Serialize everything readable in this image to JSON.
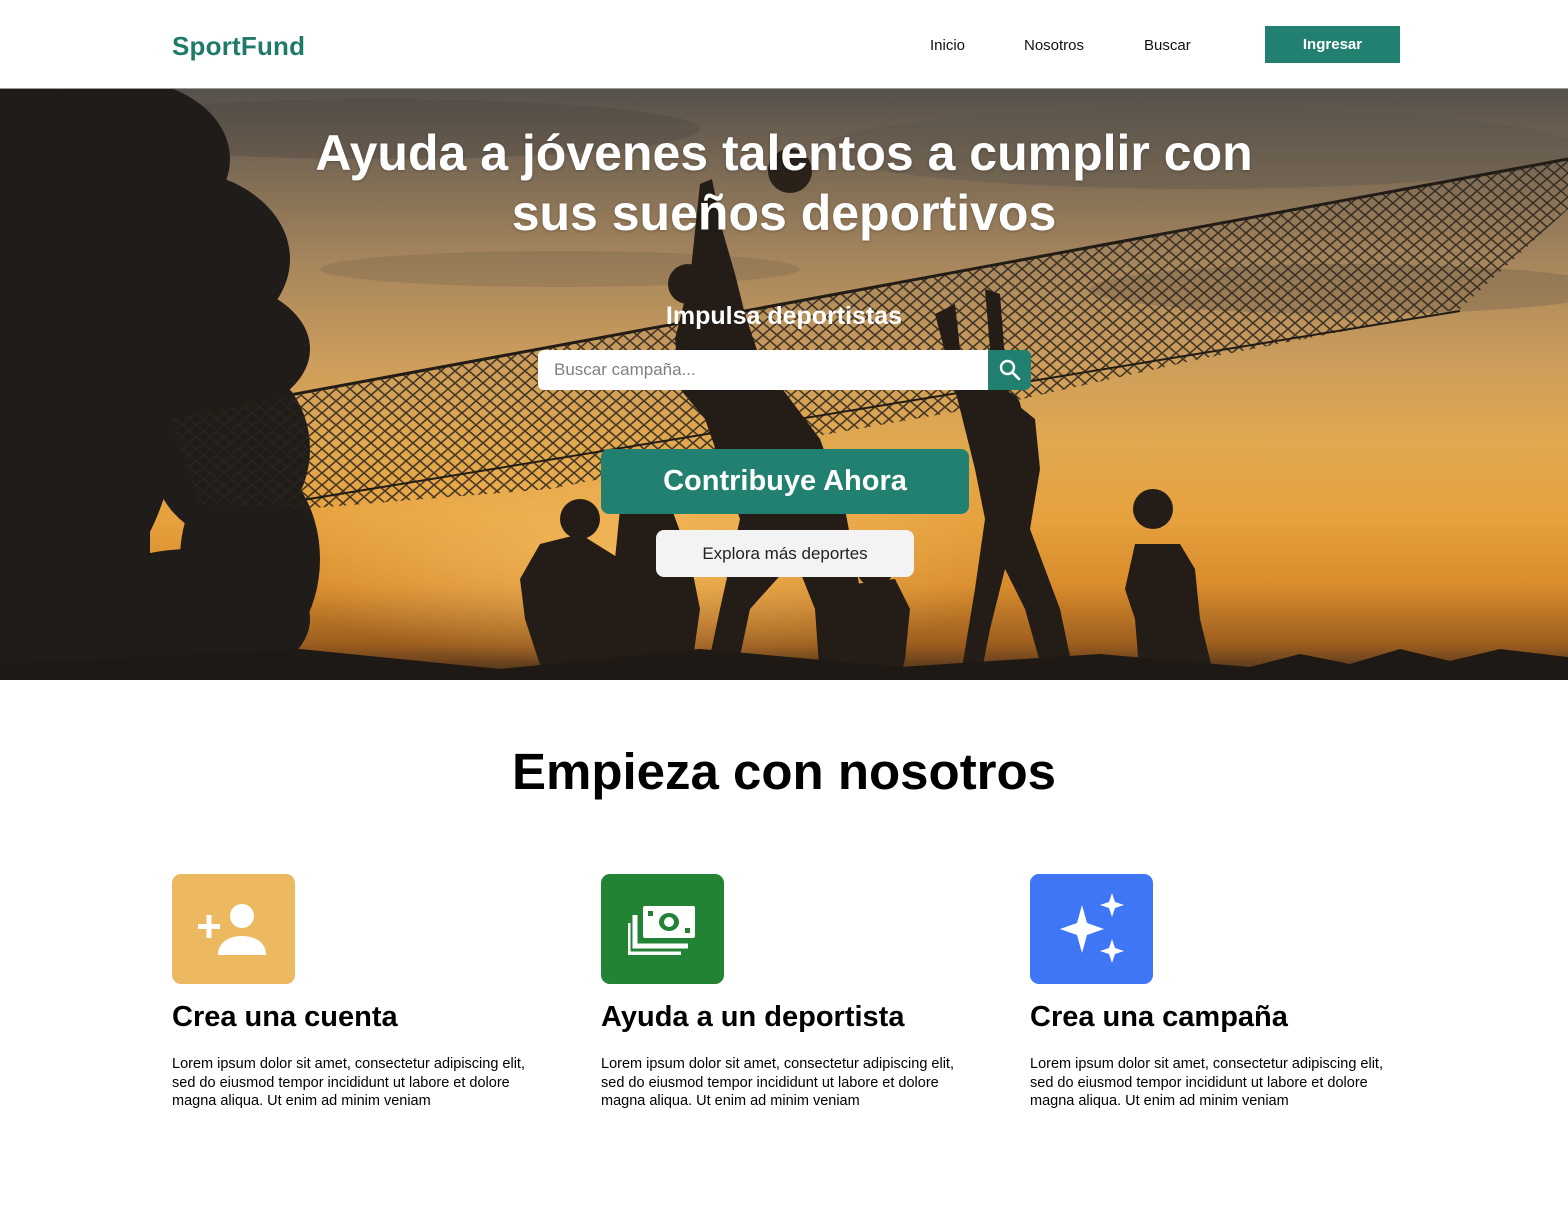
{
  "header": {
    "logo": "SportFund",
    "nav": {
      "inicio": "Inicio",
      "nosotros": "Nosotros",
      "buscar": "Buscar"
    },
    "login_label": "Ingresar"
  },
  "hero": {
    "title": "Ayuda a jóvenes talentos a cumplir con sus sueños deportivos",
    "subtitle": "Impulsa deportistas",
    "search": {
      "placeholder": "Buscar campaña...",
      "value": "",
      "button_icon": "search-icon"
    },
    "primary_cta": "Contribuye Ahora",
    "secondary_cta": "Explora más deportes"
  },
  "section": {
    "title": "Empieza con nosotros",
    "features": [
      {
        "icon": "add-person-icon",
        "icon_color": "#ecb961",
        "title": "Crea una cuenta",
        "description": "Lorem ipsum dolor sit amet, consectetur adipiscing elit, sed do eiusmod tempor incididunt ut labore et dolore magna aliqua. Ut enim ad minim veniam"
      },
      {
        "icon": "money-icon",
        "icon_color": "#228335",
        "title": "Ayuda a un deportista",
        "description": "Lorem ipsum dolor sit amet, consectetur adipiscing elit, sed do eiusmod tempor incididunt ut labore et dolore magna aliqua. Ut enim ad minim veniam"
      },
      {
        "icon": "sparkles-icon",
        "icon_color": "#3f76f5",
        "title": "Crea una campaña",
        "description": "Lorem ipsum dolor sit amet, consectetur adipiscing elit, sed do eiusmod tempor incididunt ut labore et dolore magna aliqua. Ut enim ad minim veniam"
      }
    ]
  },
  "colors": {
    "brand": "#21806f",
    "logo": "#1f7a6a"
  }
}
